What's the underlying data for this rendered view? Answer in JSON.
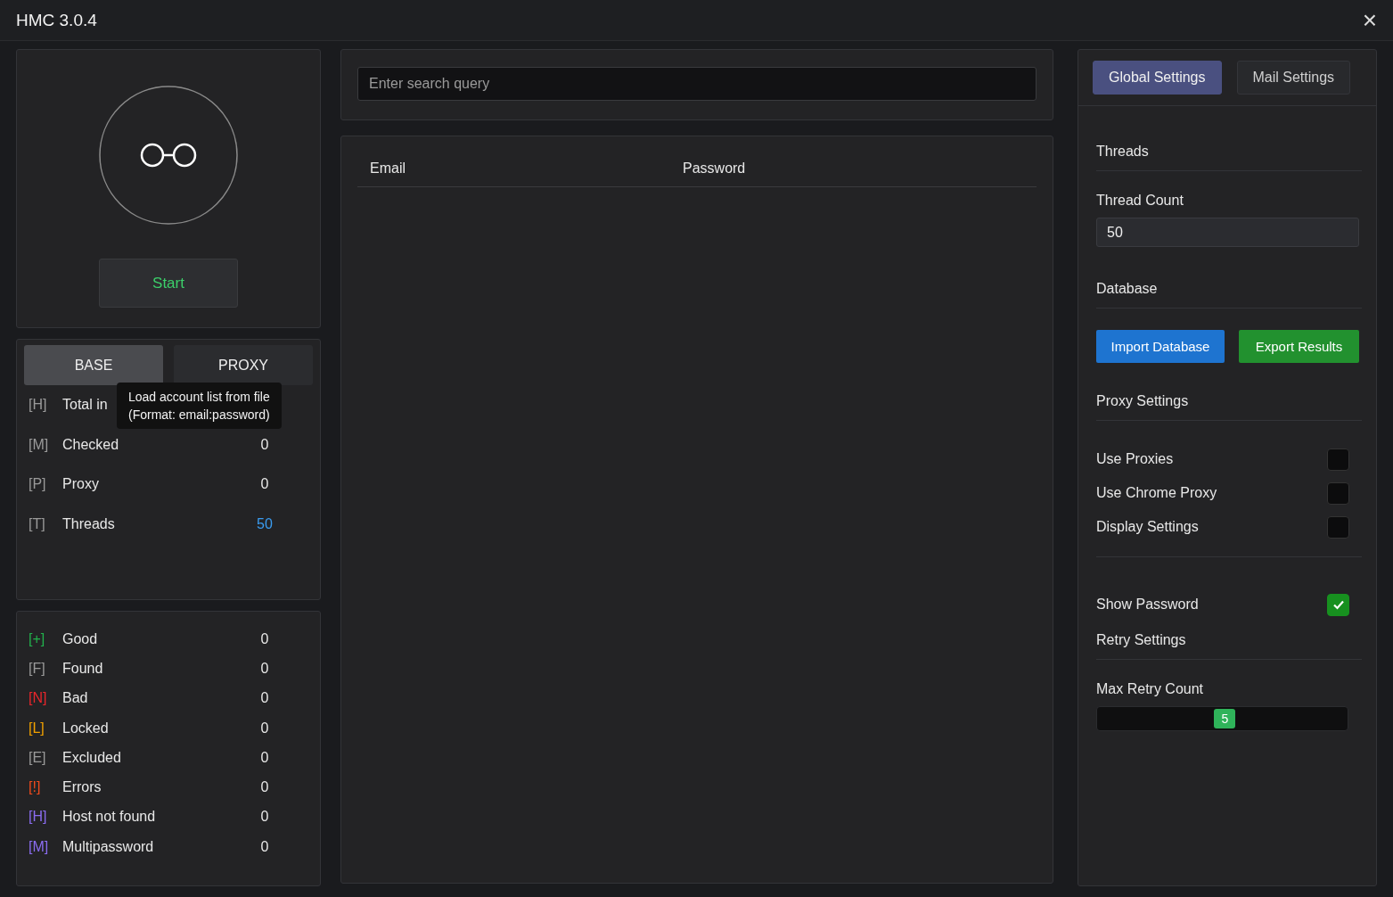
{
  "window": {
    "title": "HMC 3.0.4",
    "close": "×"
  },
  "start_button": "Start",
  "base_tabs": [
    {
      "label": "BASE",
      "selected": true
    },
    {
      "label": "PROXY",
      "selected": false
    }
  ],
  "tooltip": [
    "Load account list from file",
    "(Format: email:password)"
  ],
  "base_stats": [
    {
      "tag": "[H]",
      "label": "Total in"
    },
    {
      "tag": "[M]",
      "label": "Checked",
      "value": "0"
    },
    {
      "tag": "[P]",
      "label": "Proxy",
      "value": "0"
    },
    {
      "tag": "[T]",
      "label": "Threads",
      "value": "50",
      "highlight": true
    }
  ],
  "results": [
    {
      "tag": "[+]",
      "label": "Good",
      "value": "0",
      "color": "#22b14c"
    },
    {
      "tag": "[F]",
      "label": "Found",
      "value": "0",
      "color": "#9a9a9a"
    },
    {
      "tag": "[N]",
      "label": "Bad",
      "value": "0",
      "color": "#e8262b"
    },
    {
      "tag": "[L]",
      "label": "Locked",
      "value": "0",
      "color": "#f0a000"
    },
    {
      "tag": "[E]",
      "label": "Excluded",
      "value": "0",
      "color": "#9a9a9a"
    },
    {
      "tag": "[!]",
      "label": "Errors",
      "value": "0",
      "color": "#f04a1c"
    },
    {
      "tag": "[H]",
      "label": "Host not found",
      "value": "0",
      "color": "#8a6cf0"
    },
    {
      "tag": "[M]",
      "label": "Multipassword",
      "value": "0",
      "color": "#8a6cf0"
    }
  ],
  "search": {
    "placeholder": "Enter search query"
  },
  "table": {
    "columns": [
      "Email",
      "Password"
    ]
  },
  "settings_tabs": [
    {
      "label": "Global Settings",
      "selected": true
    },
    {
      "label": "Mail Settings",
      "selected": false
    }
  ],
  "settings": [
    {
      "kind": "heading",
      "label": "Threads"
    },
    {
      "kind": "field",
      "label": "Thread Count",
      "value": "50"
    },
    {
      "kind": "heading",
      "label": "Database"
    },
    {
      "kind": "buttons",
      "buttons": [
        "Import Database",
        "Export Results"
      ]
    },
    {
      "kind": "heading",
      "label": "Proxy Settings"
    },
    {
      "kind": "checkbox",
      "label": "Use Proxies",
      "checked": false
    },
    {
      "kind": "checkbox",
      "label": "Use Chrome Proxy",
      "checked": false
    },
    {
      "kind": "checkbox",
      "label": "Display Settings",
      "checked": false
    },
    {
      "kind": "rule"
    },
    {
      "kind": "checkbox",
      "label": "Show Password",
      "checked": true
    },
    {
      "kind": "heading",
      "label": "Retry Settings"
    },
    {
      "kind": "slider",
      "label": "Max Retry Count",
      "reading": "5",
      "level": 0.51
    }
  ]
}
